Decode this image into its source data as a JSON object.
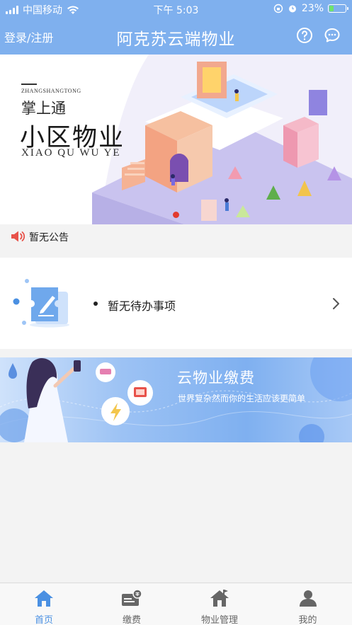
{
  "status_bar": {
    "carrier": "中国移动",
    "time": "下午 5:03",
    "battery": "23%",
    "battery_level": 0.23
  },
  "header": {
    "login_label": "登录/注册",
    "title": "阿克苏云端物业",
    "help_icon": "question-circle-icon",
    "message_icon": "chat-bubble-icon"
  },
  "banner": {
    "brand_small": "ZHANGSHANGTONG",
    "brand_line1": "掌上通",
    "brand_line2": "小区物业",
    "brand_pinyin": "XIAO QU WU YE",
    "active_dot_color": "#e23a2e"
  },
  "notice": {
    "text": "暂无公告",
    "icon": "speaker-icon"
  },
  "todo": {
    "text": "暂无待办事项",
    "icon": "ticket-edit-icon"
  },
  "payment": {
    "title": "云物业缴费",
    "subtitle": "世界复杂然而你的生活应该更简单"
  },
  "tabbar": {
    "active_color": "#4a90e2",
    "items": [
      {
        "label": "首页",
        "icon": "home-icon"
      },
      {
        "label": "缴费",
        "icon": "payment-card-icon"
      },
      {
        "label": "物业管理",
        "icon": "property-house-icon"
      },
      {
        "label": "我的",
        "icon": "user-icon"
      }
    ]
  }
}
